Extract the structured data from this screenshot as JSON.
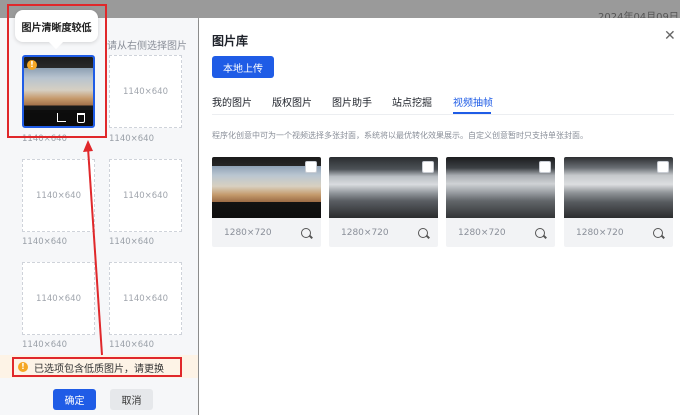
{
  "background": {
    "date_text": "2024年04月09日"
  },
  "left_panel": {
    "hint": "请从右侧选择图片",
    "tooltip": "图片清晰度较低",
    "tiles": [
      {
        "size": "1140×640"
      },
      {
        "size": "1140×640"
      },
      {
        "size": "1140×640"
      },
      {
        "size": "1140×640"
      },
      {
        "size": "1140×640"
      },
      {
        "size": "1140×640"
      }
    ],
    "captions": [
      "1140×640",
      "1140×640",
      "1140×640",
      "1140×640",
      "1140×640",
      "1140×640"
    ],
    "warning": "已选项包含低质图片，请更换",
    "confirm": "确定",
    "cancel": "取消"
  },
  "right_panel": {
    "title": "图片库",
    "close_icon": "close-icon",
    "upload_label": "本地上传",
    "tabs": [
      {
        "label": "我的图片"
      },
      {
        "label": "版权图片"
      },
      {
        "label": "图片助手"
      },
      {
        "label": "站点挖掘"
      },
      {
        "label": "视频抽帧"
      }
    ],
    "active_tab": "视频抽帧",
    "description": "程序化创意中可为一个视频选择多张封面，系统将以最优转化效果展示。自定义创意暂时只支持单张封面。",
    "images": [
      {
        "size": "1280×720"
      },
      {
        "size": "1280×720"
      },
      {
        "size": "1280×720"
      },
      {
        "size": "1280×720"
      }
    ]
  },
  "colors": {
    "primary": "#1f5ce6",
    "warning": "#f5a623",
    "annotation_red": "#e0282b"
  }
}
